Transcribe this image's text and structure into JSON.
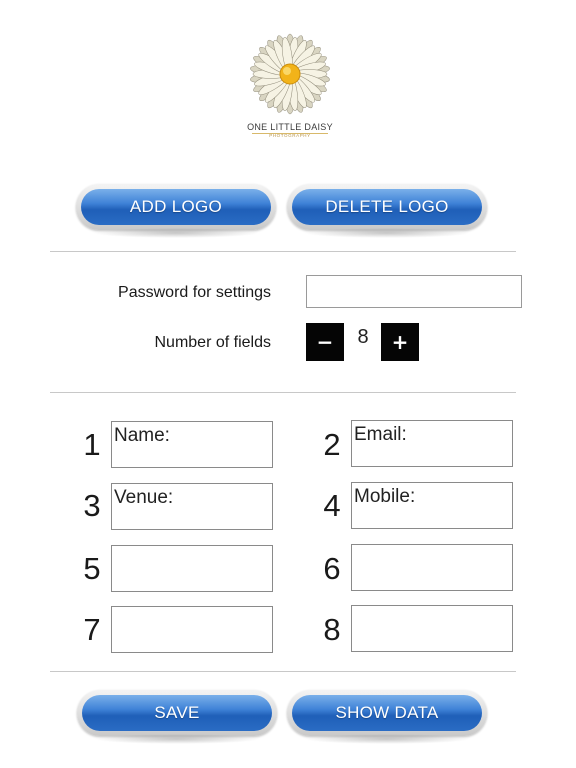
{
  "logo": {
    "name": "ONE LITTLE DAISY",
    "subtitle": "PHOTOGRAPHY",
    "icon": "daisy-flower-icon",
    "petal_color": "#f6f3e4",
    "center_color": "#f2b319"
  },
  "toolbar": {
    "add_logo_label": "ADD LOGO",
    "delete_logo_label": "DELETE LOGO"
  },
  "settings": {
    "password_label": "Password for settings",
    "password_value": "",
    "fields_label": "Number of fields",
    "minus_label": "−",
    "plus_label": "+",
    "field_count": "8"
  },
  "fields": [
    {
      "number": "1",
      "value": "Name:"
    },
    {
      "number": "2",
      "value": "Email:"
    },
    {
      "number": "3",
      "value": "Venue:"
    },
    {
      "number": "4",
      "value": "Mobile:"
    },
    {
      "number": "5",
      "value": ""
    },
    {
      "number": "6",
      "value": ""
    },
    {
      "number": "7",
      "value": ""
    },
    {
      "number": "8",
      "value": ""
    }
  ],
  "actions": {
    "save_label": "SAVE",
    "show_data_label": "SHOW DATA"
  },
  "colors": {
    "button_blue": "#3f82d7",
    "stepper_black": "#050505"
  }
}
